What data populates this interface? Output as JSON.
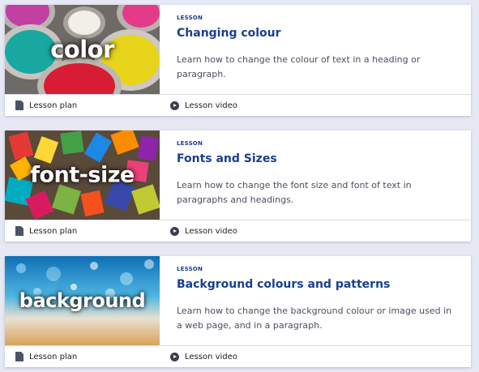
{
  "lessons": [
    {
      "thumb_word": "color",
      "kind": "LESSON",
      "title": "Changing colour",
      "description": "Learn how to change the colour of text in a heading or paragraph.",
      "plan_label": "Lesson plan",
      "video_label": "Lesson video"
    },
    {
      "thumb_word": "font-size",
      "kind": "LESSON",
      "title": "Fonts and Sizes",
      "description": "Learn how to change the font size and font of text in paragraphs and headings.",
      "plan_label": "Lesson plan",
      "video_label": "Lesson video"
    },
    {
      "thumb_word": "background",
      "kind": "LESSON",
      "title": "Background colours and patterns",
      "description": "Learn how to change the background colour or image used in a web page, and in a paragraph.",
      "plan_label": "Lesson plan",
      "video_label": "Lesson video"
    }
  ],
  "icons": {
    "plan": "document-icon",
    "video": "play-circle-icon"
  },
  "colors": {
    "page_background": "#e6e8f4",
    "title": "#1a3f8f",
    "kind_label": "#1f3a8a"
  }
}
